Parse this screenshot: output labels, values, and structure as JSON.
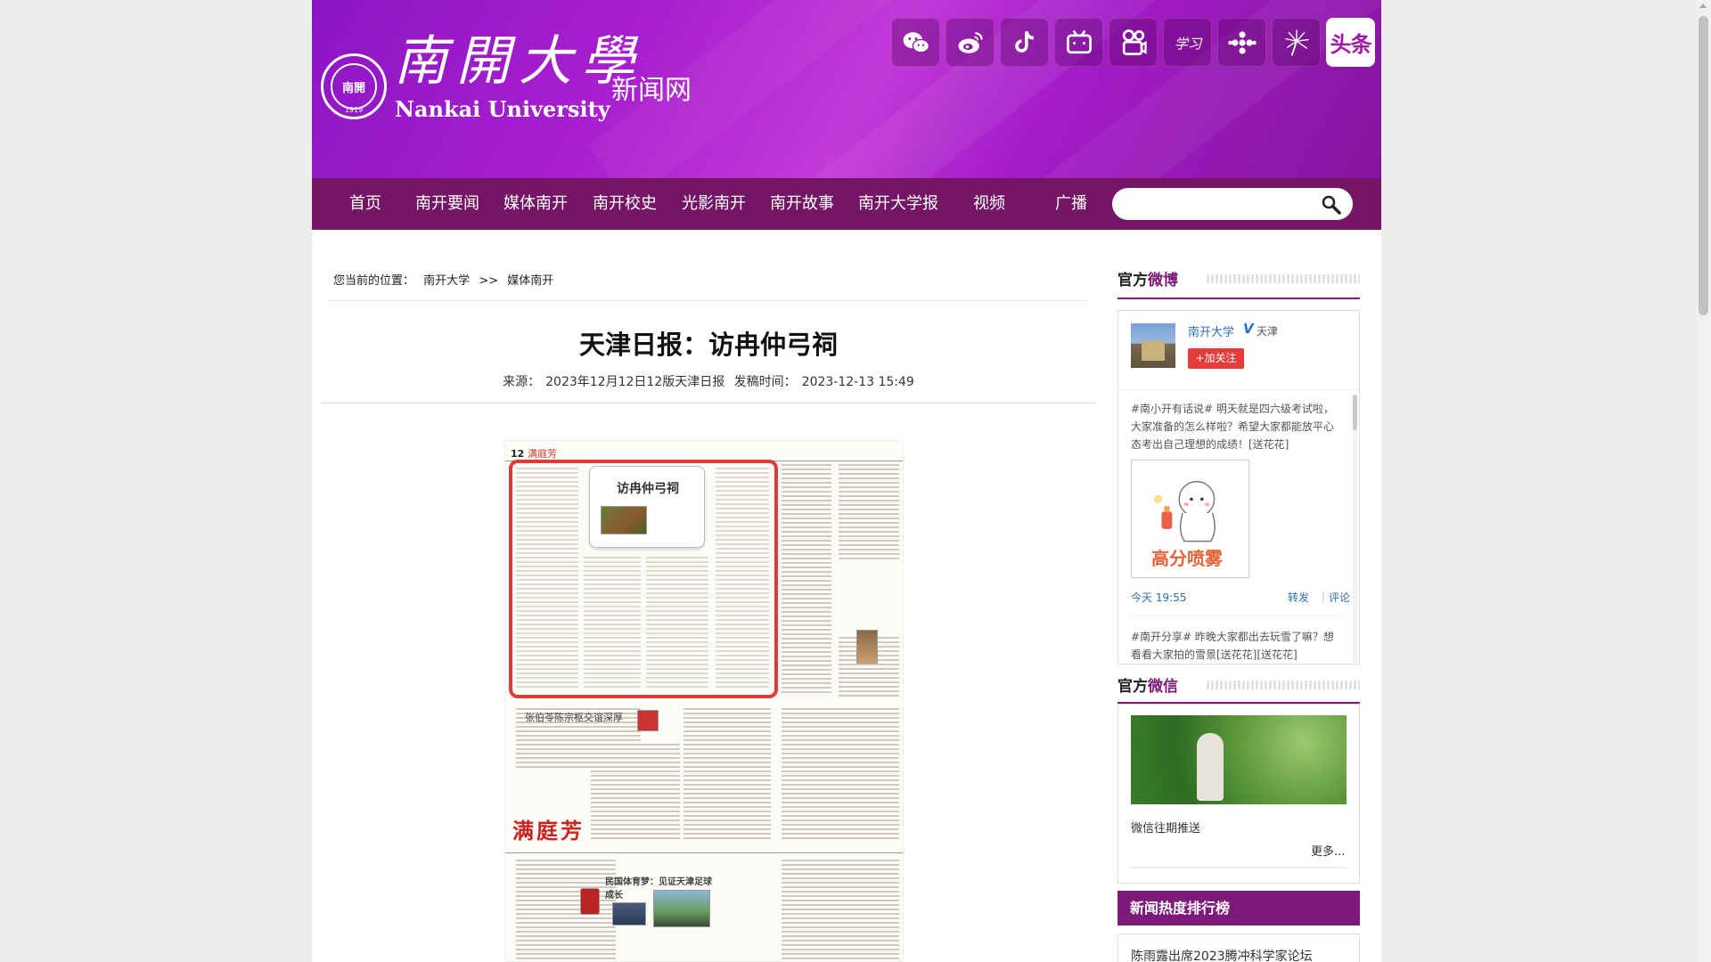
{
  "header": {
    "logo_cn": "南開大學",
    "logo_en": "Nankai University",
    "site_name": "新闻网",
    "seal_text": "南開",
    "seal_year": "1919",
    "toutiao_label": "头条",
    "social_icons": [
      "wechat-icon",
      "weibo-icon",
      "douyin-icon",
      "bilibili-icon",
      "kuaishou-icon",
      "xuexi-icon",
      "dots-icon",
      "dandelion-icon",
      "toutiao-icon"
    ]
  },
  "nav": {
    "items": [
      "首页",
      "南开要闻",
      "媒体南开",
      "南开校史",
      "光影南开",
      "南开故事",
      "南开大学报",
      "视频",
      "广播"
    ],
    "search_placeholder": ""
  },
  "breadcrumb": {
    "label": "您当前的位置：",
    "path": [
      "南开大学",
      ">>",
      "媒体南开"
    ]
  },
  "article": {
    "title": "天津日报：访冉仲弓祠",
    "source_label": "来源：",
    "source": "2023年12月12日12版天津日报",
    "date_label": "发稿时间：",
    "date": "2023-12-13 15:49"
  },
  "newspaper": {
    "page_no": "12",
    "section": "满庭芳",
    "feature_title": "访冉仲弓祠",
    "side_headline": "张伯苓陈宗枢交谊深厚",
    "section_big": "满庭芳",
    "lower_title": "民国体育梦：见证天津足球成长"
  },
  "sidebar": {
    "weibo": {
      "head_prefix": "官方",
      "head_highlight": "微博",
      "name": "南开大学",
      "verified": "V",
      "city": "天津",
      "follow_label": "+加关注",
      "post1": "#南小开有话说# 明天就是四六级考试啦，大家准备的怎么样啦？希望大家都能放平心态考出自己理想的成绩！[送花花]",
      "image_caption": "高分喷雾",
      "time": "今天 19:55",
      "repost": "转发",
      "comment": "评论",
      "post2": "#南开分享# 昨晚大家都出去玩雪了嘛？想看看大家拍的雪景[送花花][送花花]"
    },
    "wechat": {
      "head_prefix": "官方",
      "head_highlight": "微信",
      "title": "微信往期推送",
      "more": "更多..."
    },
    "ranking": {
      "head": "新闻热度排行榜",
      "items": [
        "陈雨露出席2023腾冲科学家论坛"
      ]
    }
  },
  "colors": {
    "brand_purple": "#741566",
    "accent_purple": "#7d1a79",
    "link_blue": "#2b6db8",
    "follow_red": "#e53b3b"
  }
}
